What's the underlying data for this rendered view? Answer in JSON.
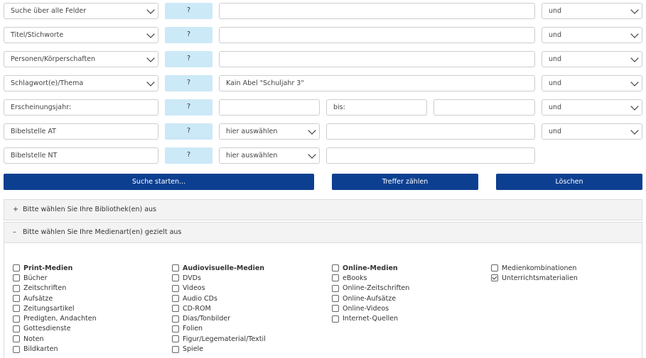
{
  "rows": [
    {
      "field": "Suche über alle Felder",
      "help": "?",
      "value": "",
      "op": "und"
    },
    {
      "field": "Titel/Stichworte",
      "help": "?",
      "value": "",
      "op": "und"
    },
    {
      "field": "Personen/Körperschaften",
      "help": "?",
      "value": "",
      "op": "und"
    },
    {
      "field": "Schlagwort(e)/Thema",
      "help": "?",
      "value": "Kain Abel \"Schuljahr 3\"",
      "op": "und"
    }
  ],
  "year_row": {
    "label": "Erscheinungsjahr:",
    "help": "?",
    "from": "",
    "bis_label": "bis:",
    "to": "",
    "op": "und"
  },
  "bible_at": {
    "label": "Bibelstelle AT",
    "help": "?",
    "select": "hier auswählen",
    "value": "",
    "op": "und"
  },
  "bible_nt": {
    "label": "Bibelstelle NT",
    "help": "?",
    "select": "hier auswählen",
    "value": ""
  },
  "buttons": {
    "search": "Suche starten...",
    "count": "Treffer zählen",
    "clear": "Löschen"
  },
  "accordion": {
    "libraries": {
      "symbol": "+",
      "label": "Bitte wählen Sie Ihre Bibliothek(en) aus"
    },
    "media": {
      "symbol": "–",
      "label": "Bitte wählen Sie Ihre Medienart(en) gezielt aus"
    }
  },
  "media_columns": [
    {
      "items": [
        {
          "label": "Print-Medien",
          "checked": false,
          "head": true
        },
        {
          "label": "Bücher",
          "checked": false
        },
        {
          "label": "Zeitschriften",
          "checked": false
        },
        {
          "label": "Aufsätze",
          "checked": false
        },
        {
          "label": "Zeitungsartikel",
          "checked": false
        },
        {
          "label": "Predigten, Andachten",
          "checked": false
        },
        {
          "label": "Gottesdienste",
          "checked": false
        },
        {
          "label": "Noten",
          "checked": false
        },
        {
          "label": "Bildkarten",
          "checked": false
        }
      ]
    },
    {
      "items": [
        {
          "label": "Audiovisuelle-Medien",
          "checked": false,
          "head": true
        },
        {
          "label": "DVDs",
          "checked": false
        },
        {
          "label": "Videos",
          "checked": false
        },
        {
          "label": "Audio CDs",
          "checked": false
        },
        {
          "label": "CD-ROM",
          "checked": false
        },
        {
          "label": "Dias/Tonbilder",
          "checked": false
        },
        {
          "label": "Folien",
          "checked": false
        },
        {
          "label": "Figur/Legematerial/Textil",
          "checked": false
        },
        {
          "label": "Spiele",
          "checked": false
        }
      ]
    },
    {
      "items": [
        {
          "label": "Online-Medien",
          "checked": false,
          "head": true
        },
        {
          "label": "eBooks",
          "checked": false
        },
        {
          "label": "Online-Zeitschriften",
          "checked": false
        },
        {
          "label": "Online-Aufsätze",
          "checked": false
        },
        {
          "label": "Online-Videos",
          "checked": false
        },
        {
          "label": "Internet-Quellen",
          "checked": false
        }
      ]
    },
    {
      "items": [
        {
          "label": "Medienkombinationen",
          "checked": false
        },
        {
          "label": "Unterrichtsmaterialien",
          "checked": true
        }
      ]
    }
  ],
  "colors": {
    "button": "#0d3f91",
    "help_bg": "#cce9f7",
    "accordion_bg": "#f3f3f3"
  }
}
